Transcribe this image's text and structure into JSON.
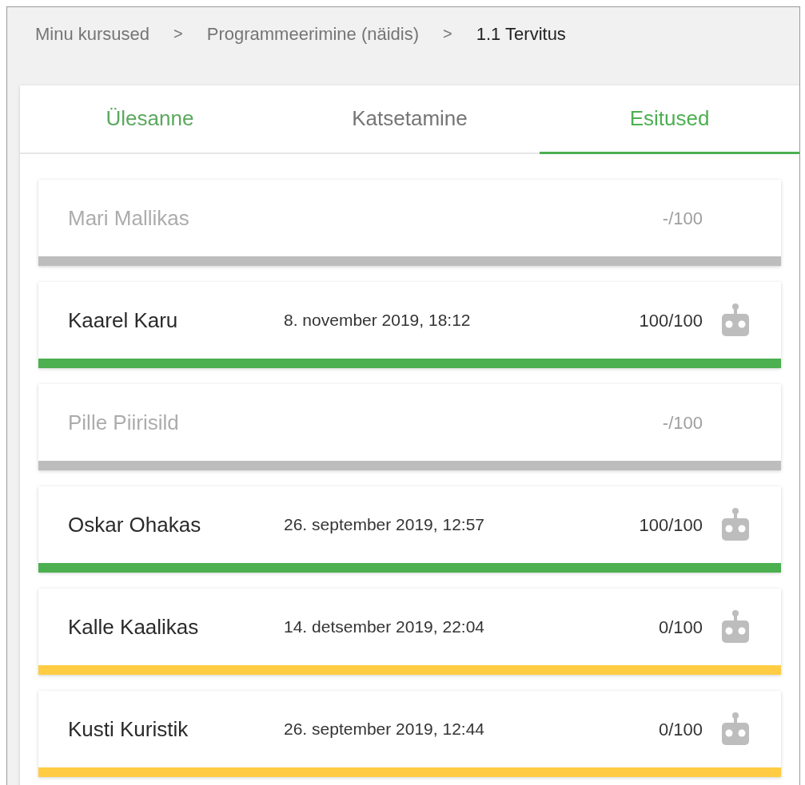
{
  "breadcrumb": [
    {
      "label": "Minu kursused",
      "current": false
    },
    {
      "label": "Programmeerimine (näidis)",
      "current": false
    },
    {
      "label": "1.1 Tervitus",
      "current": true
    }
  ],
  "breadcrumb_separator": ">",
  "tabs": [
    {
      "label": "Ülesanne",
      "selected": false
    },
    {
      "label": "Katsetamine",
      "selected": false
    },
    {
      "label": "Esitused",
      "selected": true
    }
  ],
  "submissions": [
    {
      "name": "Mari Mallikas",
      "submitted": false,
      "points": "-/100",
      "auto_graded": false,
      "color": "#bdbdbd"
    },
    {
      "name": "Kaarel Karu",
      "submitted": true,
      "date": "8. november 2019, 18:12",
      "points": "100/100",
      "auto_graded": true,
      "color": "#4caf50"
    },
    {
      "name": "Pille Piirisild",
      "submitted": false,
      "points": "-/100",
      "auto_graded": false,
      "color": "#bdbdbd"
    },
    {
      "name": "Oskar Ohakas",
      "submitted": true,
      "date": "26. september 2019, 12:57",
      "points": "100/100",
      "auto_graded": true,
      "color": "#4caf50"
    },
    {
      "name": "Kalle Kaalikas",
      "submitted": true,
      "date": "14. detsember 2019, 22:04",
      "points": "0/100",
      "auto_graded": true,
      "color": "#ffcc44"
    },
    {
      "name": "Kusti Kuristik",
      "submitted": true,
      "date": "26. september 2019, 12:44",
      "points": "0/100",
      "auto_graded": true,
      "color": "#ffcc44"
    }
  ]
}
